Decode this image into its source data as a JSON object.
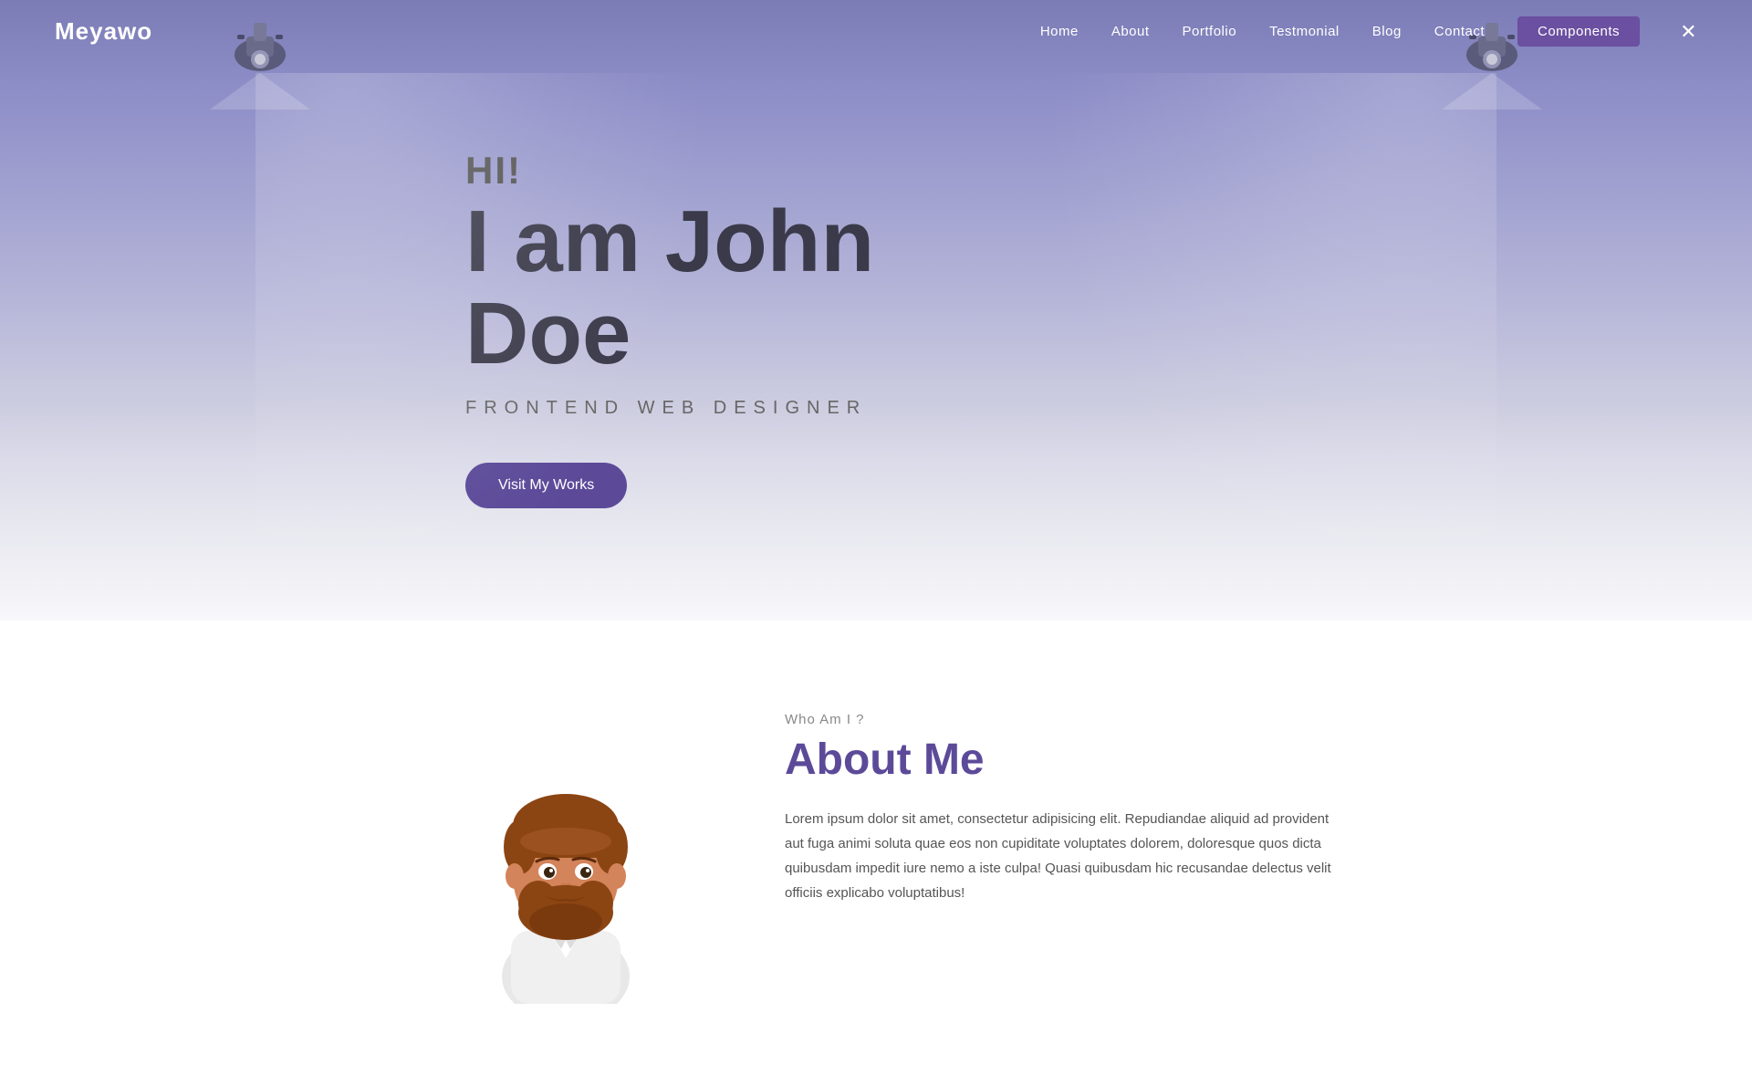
{
  "header": {
    "logo": "Meyawo",
    "nav": {
      "items": [
        {
          "label": "Home",
          "href": "#"
        },
        {
          "label": "About",
          "href": "#"
        },
        {
          "label": "Portfolio",
          "href": "#"
        },
        {
          "label": "Testmonial",
          "href": "#"
        },
        {
          "label": "Blog",
          "href": "#"
        },
        {
          "label": "Contact",
          "href": "#"
        },
        {
          "label": "Components",
          "href": "#",
          "highlighted": true
        }
      ],
      "close_label": "✕"
    }
  },
  "hero": {
    "greeting": "HI!",
    "name_line1": "I am John",
    "name_line2": "Doe",
    "subtitle": "FRONTEND WEB DESIGNER",
    "cta_button": "Visit My Works"
  },
  "about": {
    "who_label": "Who Am I ?",
    "title": "About Me",
    "body": "Lorem ipsum dolor sit amet, consectetur adipisicing elit. Repudiandae aliquid ad provident aut fuga animi soluta quae eos non cupiditate voluptates dolorem, doloresque quos dicta quibusdam impedit iure nemo a iste culpa! Quasi quibusdam hic recusandae delectus velit officiis explicabo voluptatibus!"
  },
  "colors": {
    "accent": "#5c4a99",
    "nav_highlight_bg": "#6b4fa0",
    "hero_bg_top": "#7b7bb5",
    "hero_bg_bottom": "#f8f8fb",
    "text_dark": "#3a3a4a",
    "text_muted": "#888"
  }
}
